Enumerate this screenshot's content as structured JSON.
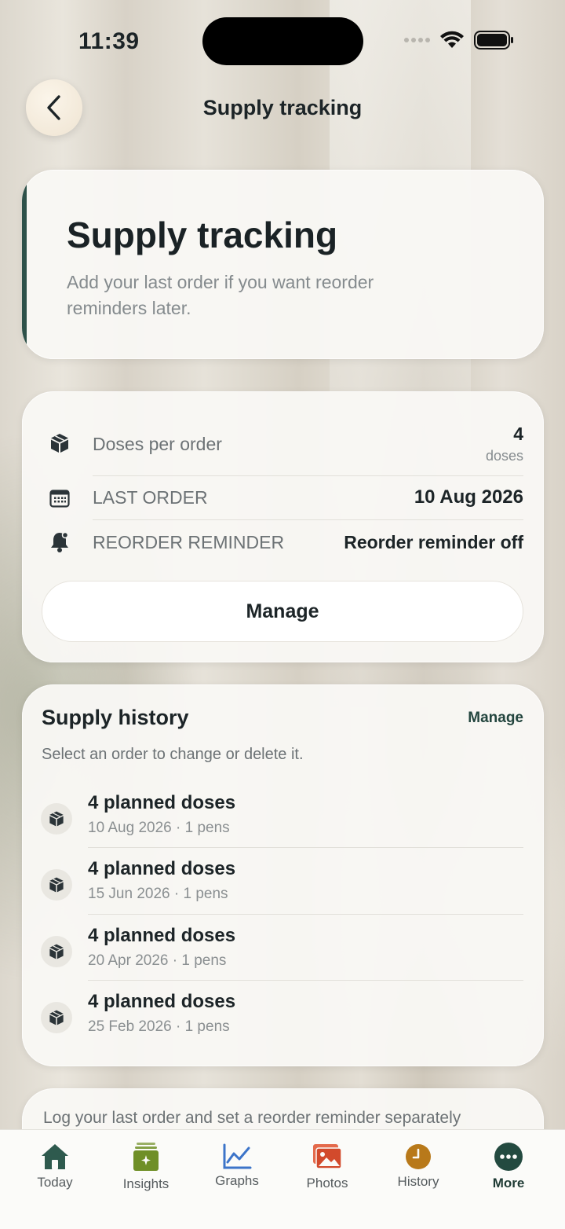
{
  "status_bar": {
    "time": "11:39"
  },
  "header": {
    "title": "Supply tracking",
    "back_icon": "chevron-left-icon"
  },
  "hero": {
    "title": "Supply tracking",
    "subtitle": "Add your last order if you want reorder reminders later."
  },
  "details": {
    "doses_label": "Doses per order",
    "doses_value": "4",
    "doses_unit": "doses",
    "last_order_label": "LAST ORDER",
    "last_order_value": "10 Aug 2026",
    "reminder_label": "REORDER REMINDER",
    "reminder_value": "Reorder reminder off",
    "manage_label": "Manage"
  },
  "history": {
    "title": "Supply history",
    "manage_label": "Manage",
    "subtitle": "Select an order to change or delete it.",
    "items": [
      {
        "title": "4 planned doses",
        "meta": "10 Aug 2026 · 1 pens"
      },
      {
        "title": "4 planned doses",
        "meta": "15 Jun 2026 · 1 pens"
      },
      {
        "title": "4 planned doses",
        "meta": "20 Apr 2026 · 1 pens"
      },
      {
        "title": "4 planned doses",
        "meta": "25 Feb 2026 · 1 pens"
      }
    ]
  },
  "footer_card": {
    "text": "Log your last order and set a reorder reminder separately"
  },
  "tabbar": {
    "tabs": [
      {
        "label": "Today",
        "icon": "home-icon",
        "color": "#2e5a4e"
      },
      {
        "label": "Insights",
        "icon": "insights-icon",
        "color": "#6f8f27"
      },
      {
        "label": "Graphs",
        "icon": "graph-icon",
        "color": "#3c74c9"
      },
      {
        "label": "Photos",
        "icon": "photos-icon",
        "color": "#d24a2c"
      },
      {
        "label": "History",
        "icon": "clock-icon",
        "color": "#b8791a"
      },
      {
        "label": "More",
        "icon": "more-icon",
        "color": "#234a40"
      }
    ],
    "active": "More"
  },
  "colors": {
    "accent": "#2d5149",
    "background_card": "#f9f8f4"
  }
}
